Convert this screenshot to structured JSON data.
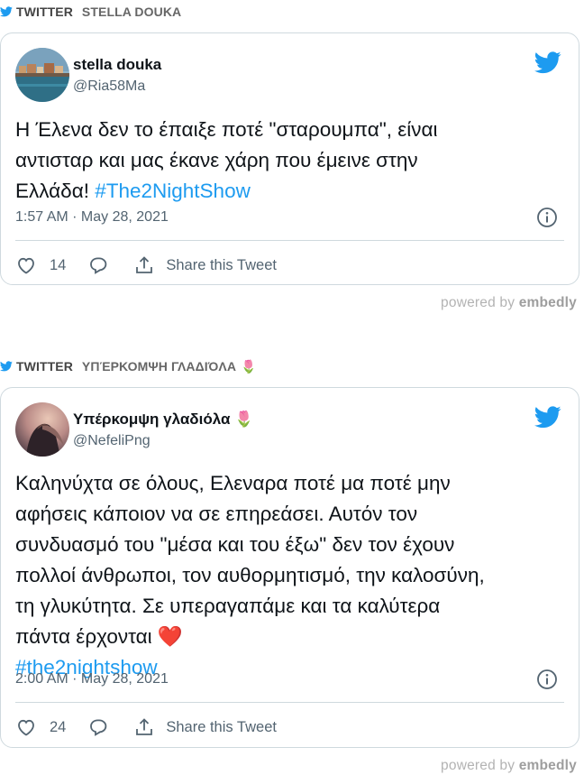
{
  "embeds": [
    {
      "provider": "TWITTER",
      "author_header": "STELLA DOUKA",
      "header_emoji": "",
      "tweet": {
        "name": "stella douka",
        "name_emoji": "",
        "handle": "@Ria58Ma",
        "text_lines": [
          "Η Έλενα δεν το έπαιξε ποτέ \"σταρουμπα\", είναι",
          "αντισταρ και μας έκανε χάρη που έμεινε στην",
          "Ελλάδα! "
        ],
        "hashtag": "#The2NightShow",
        "timestamp": "1:57 AM · May 28, 2021",
        "likes": "14",
        "share_label": "Share this Tweet"
      },
      "powered_prefix": "powered by",
      "powered_brand": "embedly"
    },
    {
      "provider": "TWITTER",
      "author_header": "ΥΠΈΡΚΟΜΨΗ ΓΛΑΔΙΌΛΑ",
      "header_emoji": "🌷",
      "tweet": {
        "name": "Υπέρκομψη γλαδιόλα",
        "name_emoji": "🌷",
        "handle": "@NefeliPng",
        "text_lines": [
          "Καληνύχτα σε όλους, Ελεναρα ποτέ μα ποτέ μην",
          "αφήσεις κάποιον να σε επηρεάσει. Αυτόν τον",
          "συνδυασμό του \"μέσα και του έξω\" δεν τον έχουν",
          "πολλοί άνθρωποι, τον αυθορμητισμό, την καλοσύνη,",
          "τη γλυκύτητα. Σε υπεραγαπάμε και τα καλύτερα",
          "πάντα έρχονται ❤️"
        ],
        "hashtag": "#the2nightshow",
        "timestamp": "2:00 AM · May 28, 2021",
        "likes": "24",
        "share_label": "Share this Tweet"
      },
      "powered_prefix": "powered by",
      "powered_brand": "embedly"
    }
  ],
  "colors": {
    "twitter_blue": "#1d9bf0",
    "text_primary": "#0f1419",
    "text_secondary": "#536471",
    "border": "#cfd9de"
  },
  "icons": {
    "bird": "twitter-bird-icon",
    "info": "info-icon",
    "like": "heart-icon",
    "reply": "reply-bubble-icon",
    "share": "share-upload-icon"
  }
}
